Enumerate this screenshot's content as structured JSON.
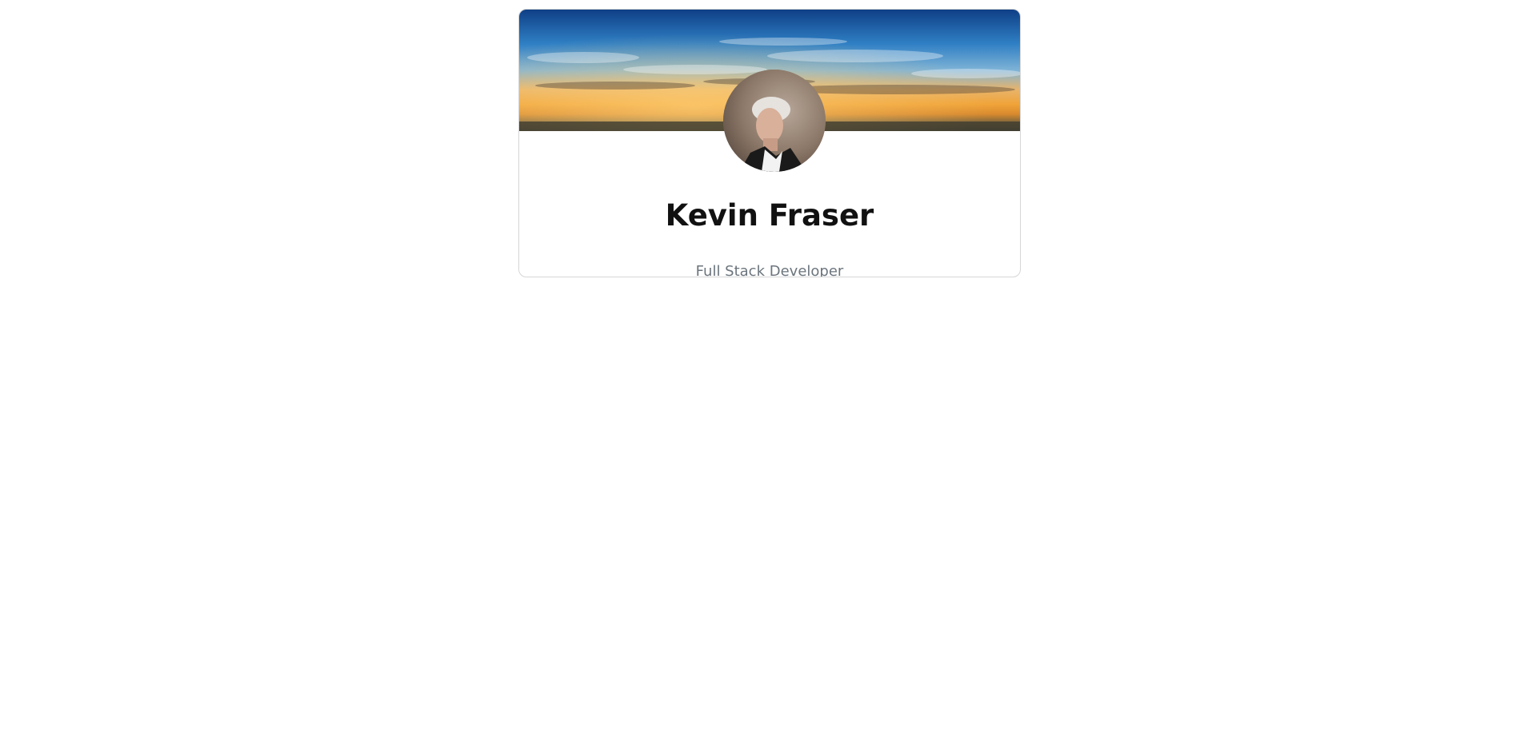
{
  "profile": {
    "name": "Kevin Fraser",
    "title": "Full Stack Developer"
  },
  "colors": {
    "name_text": "#111111",
    "title_text": "#6c757d",
    "card_border": "#d6d6d6"
  }
}
